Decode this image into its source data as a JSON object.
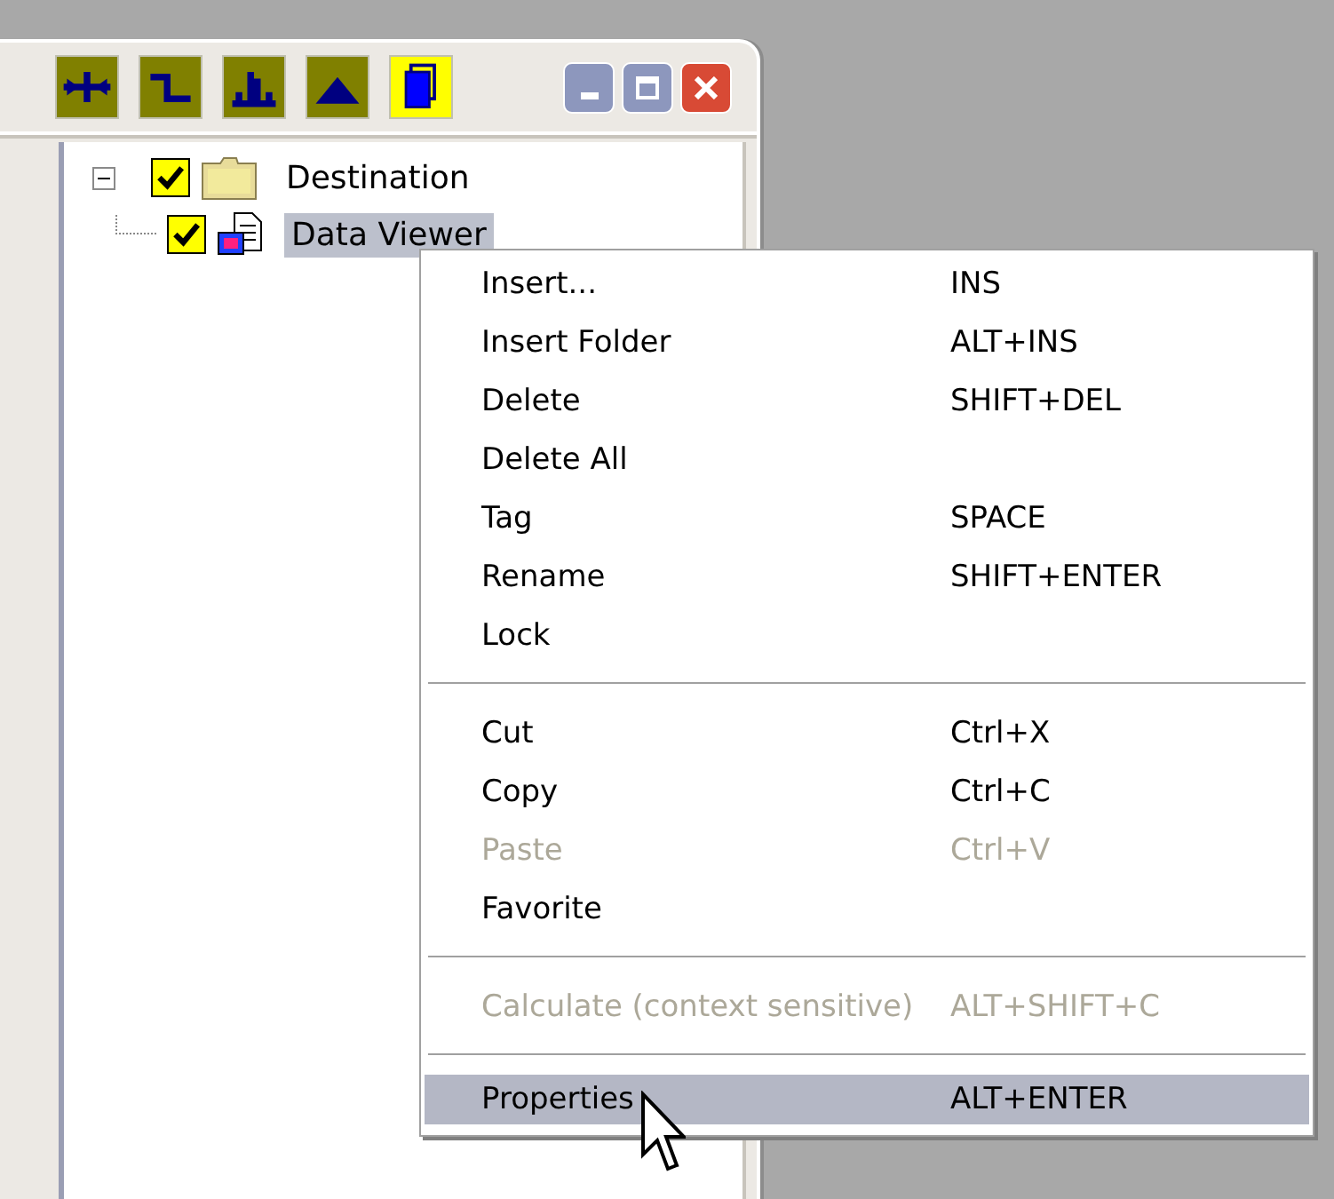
{
  "toolbar": [
    {
      "kind": "cross",
      "selected": false
    },
    {
      "kind": "step",
      "selected": false
    },
    {
      "kind": "peaks",
      "selected": false
    },
    {
      "kind": "mound",
      "selected": false
    },
    {
      "kind": "pages",
      "selected": true
    }
  ],
  "window_controls": [
    {
      "kind": "minimize"
    },
    {
      "kind": "maximize"
    },
    {
      "kind": "close"
    }
  ],
  "tree": [
    {
      "label": "Destination",
      "kind": "folder",
      "checked": true,
      "expanded": true,
      "selected": false,
      "children": [
        {
          "label": "Data Viewer",
          "kind": "viewer",
          "checked": true,
          "selected": true
        }
      ]
    }
  ],
  "context_menu": [
    {
      "kind": "item",
      "label": "Insert...",
      "shortcut": "INS",
      "disabled": false,
      "selected": false
    },
    {
      "kind": "item",
      "label": "Insert Folder",
      "shortcut": "ALT+INS",
      "disabled": false,
      "selected": false
    },
    {
      "kind": "item",
      "label": "Delete",
      "shortcut": "SHIFT+DEL",
      "disabled": false,
      "selected": false
    },
    {
      "kind": "item",
      "label": "Delete All",
      "disabled": false,
      "selected": false
    },
    {
      "kind": "item",
      "label": "Tag",
      "shortcut": "SPACE",
      "disabled": false,
      "selected": false
    },
    {
      "kind": "item",
      "label": "Rename",
      "shortcut": "SHIFT+ENTER",
      "disabled": false,
      "selected": false
    },
    {
      "kind": "item",
      "label": "Lock",
      "disabled": false,
      "selected": false
    },
    {
      "kind": "separator"
    },
    {
      "kind": "item",
      "label": "Cut",
      "shortcut": "Ctrl+X",
      "disabled": false,
      "selected": false
    },
    {
      "kind": "item",
      "label": "Copy",
      "shortcut": "Ctrl+C",
      "disabled": false,
      "selected": false
    },
    {
      "kind": "item",
      "label": "Paste",
      "shortcut": "Ctrl+V",
      "disabled": true,
      "selected": false
    },
    {
      "kind": "item",
      "label": "Favorite",
      "disabled": false,
      "selected": false
    },
    {
      "kind": "separator"
    },
    {
      "kind": "item",
      "label": "Calculate (context sensitive)",
      "shortcut": "ALT+SHIFT+C",
      "disabled": true,
      "selected": false
    },
    {
      "kind": "separator"
    },
    {
      "kind": "item",
      "label": "Properties",
      "shortcut": "ALT+ENTER",
      "disabled": false,
      "selected": true
    }
  ]
}
